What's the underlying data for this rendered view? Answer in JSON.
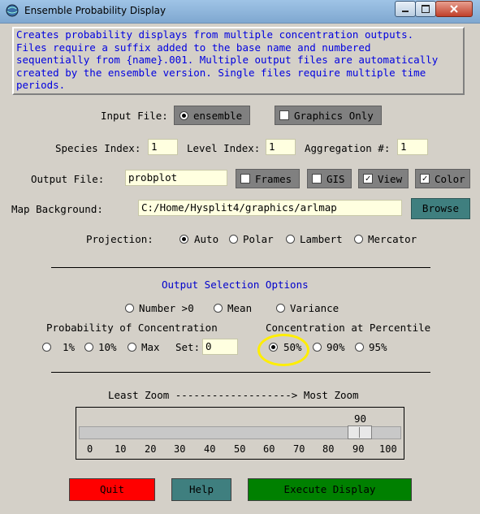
{
  "window": {
    "title": "Ensemble Probability Display",
    "controls": [
      "minimize",
      "maximize",
      "close"
    ]
  },
  "description": [
    "Creates probability displays from multiple concentration outputs.",
    "Files require a suffix added to the base name and numbered",
    "sequentially from {name}.001. Multiple output files are automatically",
    "created by the ensemble version. Single files require multiple time",
    "periods."
  ],
  "input_file": {
    "label": "Input File:",
    "option_ensemble": "ensemble",
    "option_graphics_only": "Graphics Only",
    "selected": "ensemble",
    "graphics_only_checked": false
  },
  "species": {
    "label": "Species Index:",
    "value": "1"
  },
  "level": {
    "label": "Level Index:",
    "value": "1"
  },
  "aggregation": {
    "label": "Aggregation #:",
    "value": "1"
  },
  "output_file": {
    "label": "Output File:",
    "value": "probplot"
  },
  "options": {
    "frames": {
      "label": "Frames",
      "checked": false
    },
    "gis": {
      "label": "GIS",
      "checked": false
    },
    "view": {
      "label": "View",
      "checked": true
    },
    "color": {
      "label": "Color",
      "checked": true
    }
  },
  "map_background": {
    "label": "Map Background:",
    "value": "C:/Home/Hysplit4/graphics/arlmap",
    "browse_label": "Browse"
  },
  "projection": {
    "label": "Projection:",
    "options": [
      "Auto",
      "Polar",
      "Lambert",
      "Mercator"
    ],
    "selected": "Auto"
  },
  "output_selection": {
    "heading": "Output Selection Options",
    "row1": [
      "Number >0",
      "Mean",
      "Variance"
    ],
    "prob_heading": "Probability of Concentration",
    "pct_heading": "Concentration at Percentile",
    "prob_options": [
      "1%",
      "10%",
      "Max"
    ],
    "set_label": "Set:",
    "set_value": "0",
    "pct_options": [
      "50%",
      "90%",
      "95%"
    ],
    "selected": "50%"
  },
  "zoom": {
    "label": "Least Zoom -------------------> Most Zoom",
    "value": "90",
    "ticks": [
      "0",
      "10",
      "20",
      "30",
      "40",
      "50",
      "60",
      "70",
      "80",
      "90",
      "100"
    ]
  },
  "buttons": {
    "quit": "Quit",
    "help": "Help",
    "execute": "Execute Display"
  },
  "colors": {
    "quit": "#ff0000",
    "help": "#3f7f7f",
    "execute": "#008000",
    "browse": "#3f7f7f",
    "desc_text": "#0000e0",
    "highlight": "#ffee00"
  }
}
